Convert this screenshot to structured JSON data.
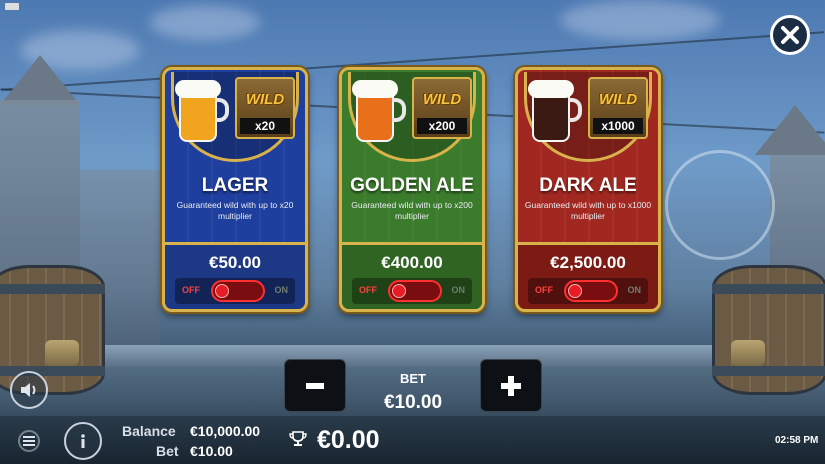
{
  "cards": [
    {
      "title": "LAGER",
      "description": "Guaranteed wild with up to x20 multiplier",
      "wild_label": "WILD",
      "multiplier": "x20",
      "price": "€50.00",
      "toggle": {
        "off_label": "OFF",
        "on_label": "ON",
        "state": "off"
      },
      "color": "#1f3f9e",
      "beer_color": "#f1a51f"
    },
    {
      "title": "GOLDEN ALE",
      "description": "Guaranteed wild with up to x200 multiplier",
      "wild_label": "WILD",
      "multiplier": "x200",
      "price": "€400.00",
      "toggle": {
        "off_label": "OFF",
        "on_label": "ON",
        "state": "off"
      },
      "color": "#3b7c2c",
      "beer_color": "#e9701a"
    },
    {
      "title": "DARK ALE",
      "description": "Guaranteed wild with up to x1000 multiplier",
      "wild_label": "WILD",
      "multiplier": "x1000",
      "price": "€2,500.00",
      "toggle": {
        "off_label": "OFF",
        "on_label": "ON",
        "state": "off"
      },
      "color": "#a02820",
      "beer_color": "#3a1a12"
    }
  ],
  "bet_panel": {
    "label": "BET",
    "value": "€10.00",
    "minus_label": "-",
    "plus_label": "+"
  },
  "footer": {
    "balance_label": "Balance",
    "balance_value": "€10,000.00",
    "bet_label": "Bet",
    "bet_value": "€10.00",
    "win_value": "€0.00",
    "clock": "02:58 PM"
  },
  "icons": {
    "close": "close-icon",
    "sound": "speaker-icon",
    "menu": "hamburger-menu-icon",
    "info": "info-icon",
    "trophy": "trophy-icon"
  }
}
